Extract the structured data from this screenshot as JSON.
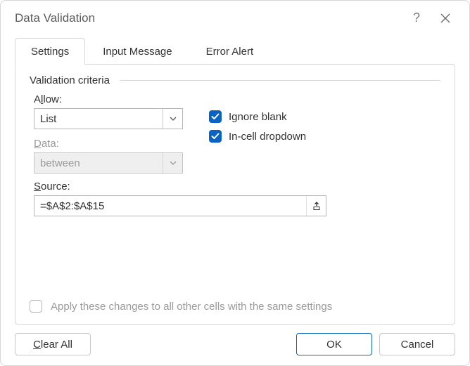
{
  "title": "Data Validation",
  "help_glyph": "?",
  "tabs": {
    "settings": "Settings",
    "input_message": "Input Message",
    "error_alert": "Error Alert"
  },
  "settings": {
    "criteria_label": "Validation criteria",
    "allow_label_pre": "A",
    "allow_label_ul": "l",
    "allow_label_post": "low:",
    "allow_value": "List",
    "data_label_pre": "",
    "data_label_ul": "D",
    "data_label_post": "ata:",
    "data_value": "between",
    "source_label_pre": "",
    "source_label_ul": "S",
    "source_label_post": "ource:",
    "source_value": "=$A$2:$A$15",
    "ignore_blank_pre": "Ignore ",
    "ignore_blank_ul": "b",
    "ignore_blank_post": "lank",
    "incell_pre": "",
    "incell_ul": "I",
    "incell_post": "n-cell dropdown",
    "apply_label_pre": "Apply these changes to all other cells with the same settings",
    "apply_label_ul": "",
    "apply_label_post": ""
  },
  "buttons": {
    "clear_pre": "",
    "clear_ul": "C",
    "clear_post": "lear All",
    "ok": "OK",
    "cancel": "Cancel"
  }
}
